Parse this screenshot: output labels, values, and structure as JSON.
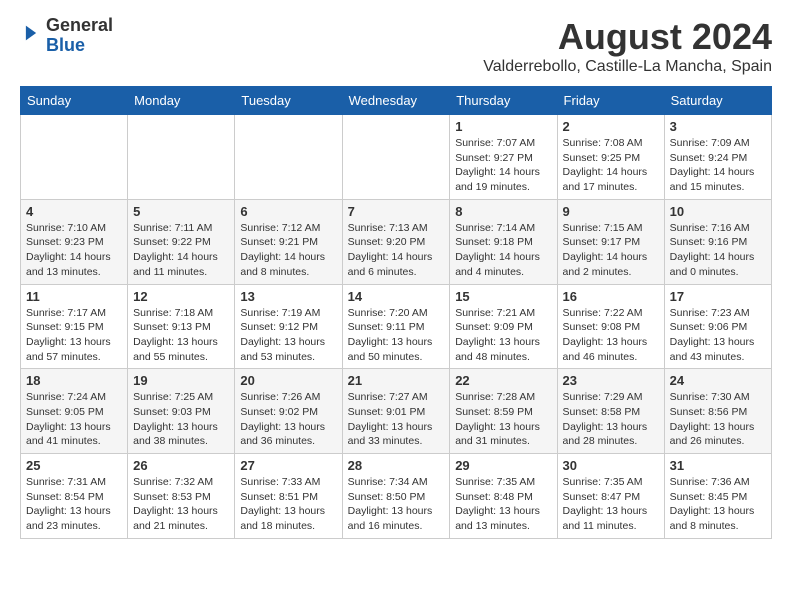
{
  "header": {
    "logo": {
      "line1": "General",
      "line2": "Blue"
    },
    "title": "August 2024",
    "subtitle": "Valderrebollo, Castille-La Mancha, Spain"
  },
  "calendar": {
    "headers": [
      "Sunday",
      "Monday",
      "Tuesday",
      "Wednesday",
      "Thursday",
      "Friday",
      "Saturday"
    ],
    "weeks": [
      [
        {
          "day": "",
          "info": ""
        },
        {
          "day": "",
          "info": ""
        },
        {
          "day": "",
          "info": ""
        },
        {
          "day": "",
          "info": ""
        },
        {
          "day": "1",
          "info": "Sunrise: 7:07 AM\nSunset: 9:27 PM\nDaylight: 14 hours\nand 19 minutes."
        },
        {
          "day": "2",
          "info": "Sunrise: 7:08 AM\nSunset: 9:25 PM\nDaylight: 14 hours\nand 17 minutes."
        },
        {
          "day": "3",
          "info": "Sunrise: 7:09 AM\nSunset: 9:24 PM\nDaylight: 14 hours\nand 15 minutes."
        }
      ],
      [
        {
          "day": "4",
          "info": "Sunrise: 7:10 AM\nSunset: 9:23 PM\nDaylight: 14 hours\nand 13 minutes."
        },
        {
          "day": "5",
          "info": "Sunrise: 7:11 AM\nSunset: 9:22 PM\nDaylight: 14 hours\nand 11 minutes."
        },
        {
          "day": "6",
          "info": "Sunrise: 7:12 AM\nSunset: 9:21 PM\nDaylight: 14 hours\nand 8 minutes."
        },
        {
          "day": "7",
          "info": "Sunrise: 7:13 AM\nSunset: 9:20 PM\nDaylight: 14 hours\nand 6 minutes."
        },
        {
          "day": "8",
          "info": "Sunrise: 7:14 AM\nSunset: 9:18 PM\nDaylight: 14 hours\nand 4 minutes."
        },
        {
          "day": "9",
          "info": "Sunrise: 7:15 AM\nSunset: 9:17 PM\nDaylight: 14 hours\nand 2 minutes."
        },
        {
          "day": "10",
          "info": "Sunrise: 7:16 AM\nSunset: 9:16 PM\nDaylight: 14 hours\nand 0 minutes."
        }
      ],
      [
        {
          "day": "11",
          "info": "Sunrise: 7:17 AM\nSunset: 9:15 PM\nDaylight: 13 hours\nand 57 minutes."
        },
        {
          "day": "12",
          "info": "Sunrise: 7:18 AM\nSunset: 9:13 PM\nDaylight: 13 hours\nand 55 minutes."
        },
        {
          "day": "13",
          "info": "Sunrise: 7:19 AM\nSunset: 9:12 PM\nDaylight: 13 hours\nand 53 minutes."
        },
        {
          "day": "14",
          "info": "Sunrise: 7:20 AM\nSunset: 9:11 PM\nDaylight: 13 hours\nand 50 minutes."
        },
        {
          "day": "15",
          "info": "Sunrise: 7:21 AM\nSunset: 9:09 PM\nDaylight: 13 hours\nand 48 minutes."
        },
        {
          "day": "16",
          "info": "Sunrise: 7:22 AM\nSunset: 9:08 PM\nDaylight: 13 hours\nand 46 minutes."
        },
        {
          "day": "17",
          "info": "Sunrise: 7:23 AM\nSunset: 9:06 PM\nDaylight: 13 hours\nand 43 minutes."
        }
      ],
      [
        {
          "day": "18",
          "info": "Sunrise: 7:24 AM\nSunset: 9:05 PM\nDaylight: 13 hours\nand 41 minutes."
        },
        {
          "day": "19",
          "info": "Sunrise: 7:25 AM\nSunset: 9:03 PM\nDaylight: 13 hours\nand 38 minutes."
        },
        {
          "day": "20",
          "info": "Sunrise: 7:26 AM\nSunset: 9:02 PM\nDaylight: 13 hours\nand 36 minutes."
        },
        {
          "day": "21",
          "info": "Sunrise: 7:27 AM\nSunset: 9:01 PM\nDaylight: 13 hours\nand 33 minutes."
        },
        {
          "day": "22",
          "info": "Sunrise: 7:28 AM\nSunset: 8:59 PM\nDaylight: 13 hours\nand 31 minutes."
        },
        {
          "day": "23",
          "info": "Sunrise: 7:29 AM\nSunset: 8:58 PM\nDaylight: 13 hours\nand 28 minutes."
        },
        {
          "day": "24",
          "info": "Sunrise: 7:30 AM\nSunset: 8:56 PM\nDaylight: 13 hours\nand 26 minutes."
        }
      ],
      [
        {
          "day": "25",
          "info": "Sunrise: 7:31 AM\nSunset: 8:54 PM\nDaylight: 13 hours\nand 23 minutes."
        },
        {
          "day": "26",
          "info": "Sunrise: 7:32 AM\nSunset: 8:53 PM\nDaylight: 13 hours\nand 21 minutes."
        },
        {
          "day": "27",
          "info": "Sunrise: 7:33 AM\nSunset: 8:51 PM\nDaylight: 13 hours\nand 18 minutes."
        },
        {
          "day": "28",
          "info": "Sunrise: 7:34 AM\nSunset: 8:50 PM\nDaylight: 13 hours\nand 16 minutes."
        },
        {
          "day": "29",
          "info": "Sunrise: 7:35 AM\nSunset: 8:48 PM\nDaylight: 13 hours\nand 13 minutes."
        },
        {
          "day": "30",
          "info": "Sunrise: 7:35 AM\nSunset: 8:47 PM\nDaylight: 13 hours\nand 11 minutes."
        },
        {
          "day": "31",
          "info": "Sunrise: 7:36 AM\nSunset: 8:45 PM\nDaylight: 13 hours\nand 8 minutes."
        }
      ]
    ]
  }
}
